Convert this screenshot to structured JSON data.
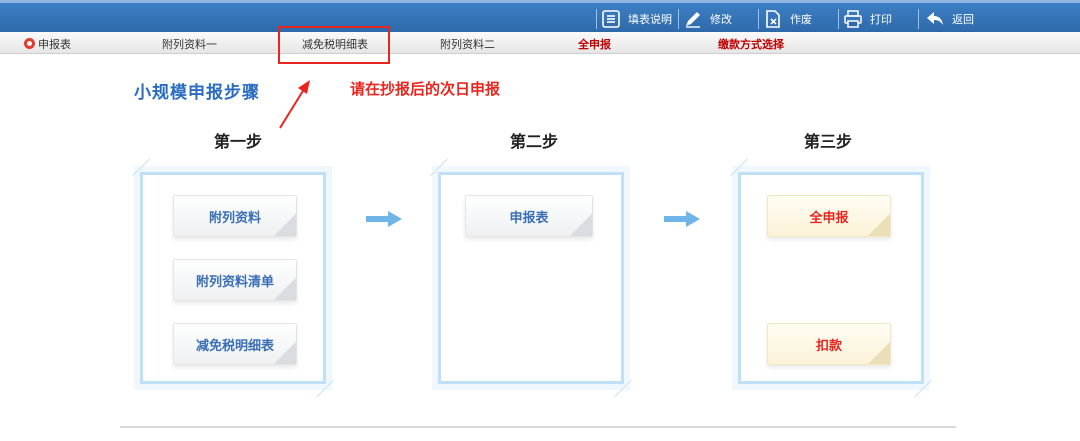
{
  "toolbar": {
    "fill_guide": "填表说明",
    "modify": "修改",
    "void": "作废",
    "print": "打印",
    "back": "返回"
  },
  "tabs": [
    {
      "label": "申报表"
    },
    {
      "label": "附列资料一"
    },
    {
      "label": "减免税明细表"
    },
    {
      "label": "附列资料二"
    },
    {
      "label": "全申报"
    },
    {
      "label": "缴款方式选择"
    }
  ],
  "main": {
    "title": "小规模申报步骤",
    "annotation": "请在抄报后的次日申报"
  },
  "steps": [
    {
      "title": "第一步",
      "items": [
        "附列资料",
        "附列资料清单",
        "减免税明细表"
      ]
    },
    {
      "title": "第二步",
      "items": [
        "申报表"
      ]
    },
    {
      "title": "第三步",
      "items": [
        "全申报",
        "扣款"
      ]
    }
  ],
  "colors": {
    "topbar": "#2e6aab",
    "accent_blue": "#2a6cc0",
    "annotation_red": "#e8261f",
    "panel_border": "#bfe0f6",
    "arrow": "#6fb5e8"
  }
}
